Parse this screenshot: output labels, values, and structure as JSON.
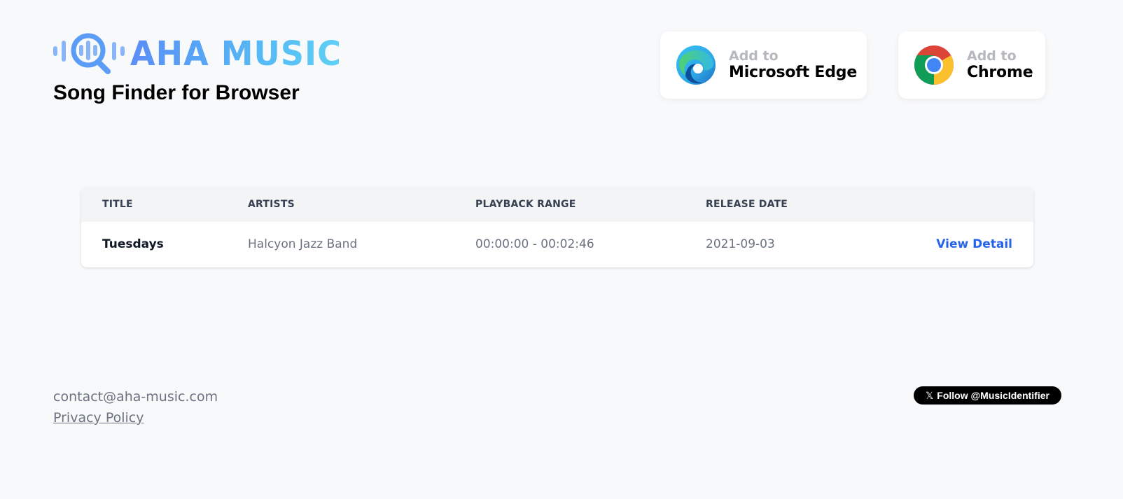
{
  "header": {
    "logo_text": "AHA MUSIC",
    "subtitle": "Song Finder for Browser",
    "logo_icon": "magnifier-sound-wave-icon"
  },
  "stores": {
    "edge": {
      "add_label": "Add to",
      "name": "Microsoft Edge",
      "icon": "microsoft-edge-icon"
    },
    "chrome": {
      "add_label": "Add to",
      "name": "Chrome",
      "icon": "chrome-icon"
    }
  },
  "results": {
    "columns": [
      "TITLE",
      "ARTISTS",
      "PLAYBACK RANGE",
      "RELEASE DATE"
    ],
    "rows": [
      {
        "title": "Tuesdays",
        "artists": "Halcyon Jazz Band",
        "playback_range": "00:00:00 - 00:02:46",
        "release_date": "2021-09-03",
        "action": "View Detail"
      }
    ]
  },
  "footer": {
    "contact": "contact@aha-music.com",
    "privacy": "Privacy Policy",
    "follow_label": "Follow @MusicIdentifier",
    "follow_icon": "x-logo-icon"
  },
  "colors": {
    "background": "#f8f9fb",
    "logo_blue": "#56b8f5",
    "link_blue": "#2563eb",
    "follow_button": "#000000"
  }
}
